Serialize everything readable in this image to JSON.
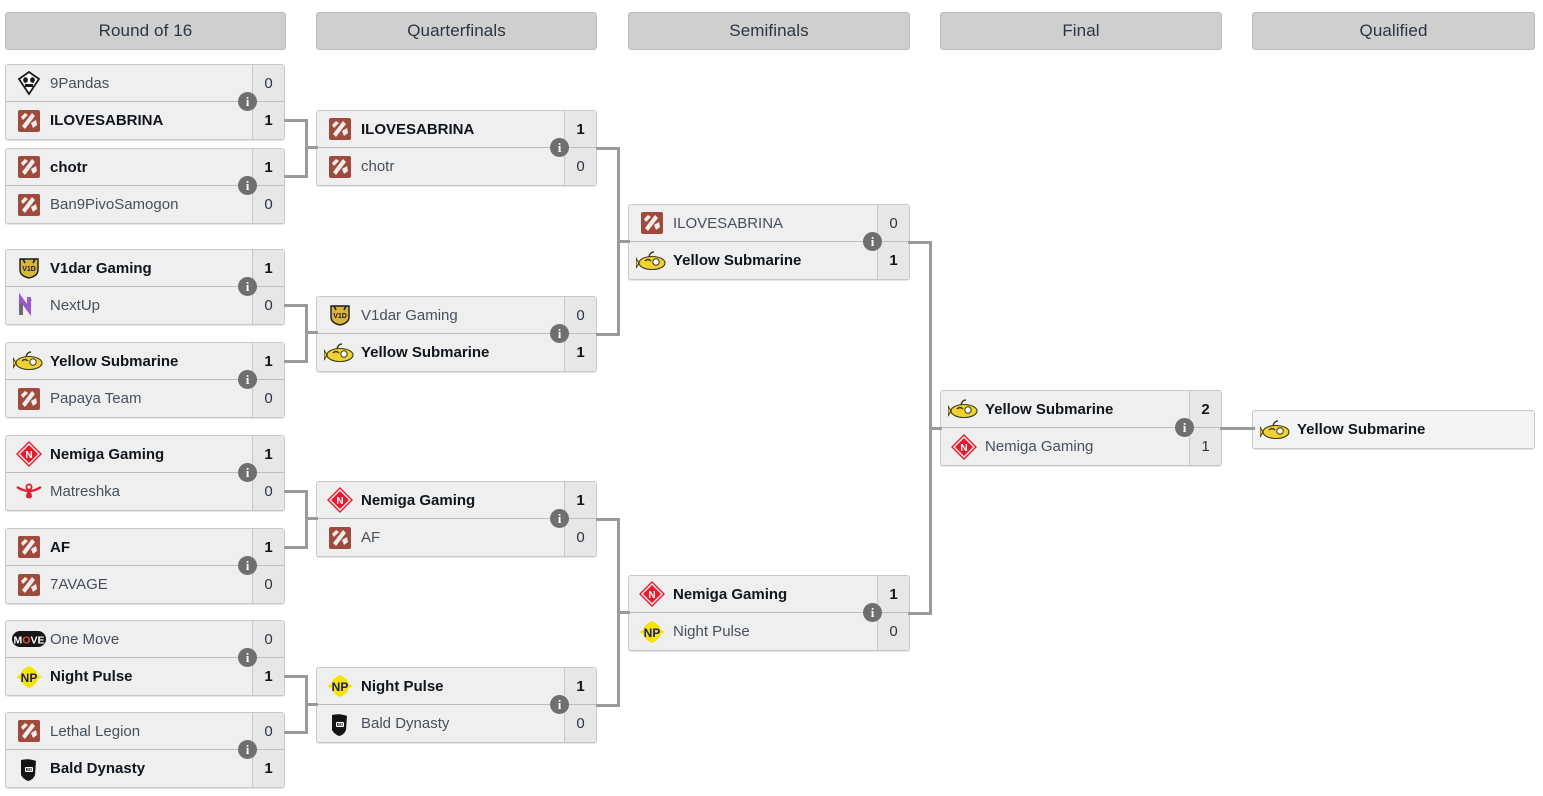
{
  "rounds": [
    {
      "label": "Round of 16"
    },
    {
      "label": "Quarterfinals"
    },
    {
      "label": "Semifinals"
    },
    {
      "label": "Final"
    },
    {
      "label": "Qualified"
    }
  ],
  "info_glyph": "i",
  "colors": {
    "header_bg": "#cfcfcf",
    "match_bg": "#efefef",
    "score_bg": "#e7e7e7",
    "connector": "#9a9a9a",
    "info_badge": "#6f6f6f",
    "text": "#2b3642"
  },
  "matches": {
    "r16_m1": {
      "top": {
        "name": "9Pandas",
        "score": "0",
        "logo": "9pandas-logo",
        "winner": false
      },
      "bottom": {
        "name": "ILOVESABRINA",
        "score": "1",
        "logo": "dota-generic-logo",
        "winner": true
      }
    },
    "r16_m2": {
      "top": {
        "name": "chotr",
        "score": "1",
        "logo": "dota-generic-logo",
        "winner": true
      },
      "bottom": {
        "name": "Ban9PivoSamogon",
        "score": "0",
        "logo": "dota-generic-logo",
        "winner": false
      }
    },
    "r16_m3": {
      "top": {
        "name": "V1dar Gaming",
        "score": "1",
        "logo": "v1dar-logo",
        "winner": true
      },
      "bottom": {
        "name": "NextUp",
        "score": "0",
        "logo": "nextup-logo",
        "winner": false
      }
    },
    "r16_m4": {
      "top": {
        "name": "Yellow Submarine",
        "score": "1",
        "logo": "yellow-submarine-logo",
        "winner": true
      },
      "bottom": {
        "name": "Papaya Team",
        "score": "0",
        "logo": "dota-generic-logo",
        "winner": false
      }
    },
    "r16_m5": {
      "top": {
        "name": "Nemiga Gaming",
        "score": "1",
        "logo": "nemiga-logo",
        "winner": true
      },
      "bottom": {
        "name": "Matreshka",
        "score": "0",
        "logo": "matreshka-logo",
        "winner": false
      }
    },
    "r16_m6": {
      "top": {
        "name": "AF",
        "score": "1",
        "logo": "dota-generic-logo",
        "winner": true
      },
      "bottom": {
        "name": "7AVAGE",
        "score": "0",
        "logo": "dota-generic-logo",
        "winner": false
      }
    },
    "r16_m7": {
      "top": {
        "name": "One Move",
        "score": "0",
        "logo": "one-move-logo",
        "winner": false
      },
      "bottom": {
        "name": "Night Pulse",
        "score": "1",
        "logo": "night-pulse-logo",
        "winner": true
      }
    },
    "r16_m8": {
      "top": {
        "name": "Lethal Legion",
        "score": "0",
        "logo": "dota-generic-logo",
        "winner": false
      },
      "bottom": {
        "name": "Bald Dynasty",
        "score": "1",
        "logo": "bald-dynasty-logo",
        "winner": true
      }
    },
    "qf_m1": {
      "top": {
        "name": "ILOVESABRINA",
        "score": "1",
        "logo": "dota-generic-logo",
        "winner": true
      },
      "bottom": {
        "name": "chotr",
        "score": "0",
        "logo": "dota-generic-logo",
        "winner": false
      }
    },
    "qf_m2": {
      "top": {
        "name": "V1dar Gaming",
        "score": "0",
        "logo": "v1dar-logo",
        "winner": false
      },
      "bottom": {
        "name": "Yellow Submarine",
        "score": "1",
        "logo": "yellow-submarine-logo",
        "winner": true
      }
    },
    "qf_m3": {
      "top": {
        "name": "Nemiga Gaming",
        "score": "1",
        "logo": "nemiga-logo",
        "winner": true
      },
      "bottom": {
        "name": "AF",
        "score": "0",
        "logo": "dota-generic-logo",
        "winner": false
      }
    },
    "qf_m4": {
      "top": {
        "name": "Night Pulse",
        "score": "1",
        "logo": "night-pulse-logo",
        "winner": true
      },
      "bottom": {
        "name": "Bald Dynasty",
        "score": "0",
        "logo": "bald-dynasty-logo",
        "winner": false
      }
    },
    "sf_m1": {
      "top": {
        "name": "ILOVESABRINA",
        "score": "0",
        "logo": "dota-generic-logo",
        "winner": false
      },
      "bottom": {
        "name": "Yellow Submarine",
        "score": "1",
        "logo": "yellow-submarine-logo",
        "winner": true
      }
    },
    "sf_m2": {
      "top": {
        "name": "Nemiga Gaming",
        "score": "1",
        "logo": "nemiga-logo",
        "winner": true
      },
      "bottom": {
        "name": "Night Pulse",
        "score": "0",
        "logo": "night-pulse-logo",
        "winner": false
      }
    },
    "final_m1": {
      "top": {
        "name": "Yellow Submarine",
        "score": "2",
        "logo": "yellow-submarine-logo",
        "winner": true
      },
      "bottom": {
        "name": "Nemiga Gaming",
        "score": "1",
        "logo": "nemiga-logo",
        "winner": false
      }
    },
    "qualified_m1": {
      "top": {
        "name": "Yellow Submarine",
        "logo": "yellow-submarine-logo",
        "winner": true
      }
    }
  }
}
